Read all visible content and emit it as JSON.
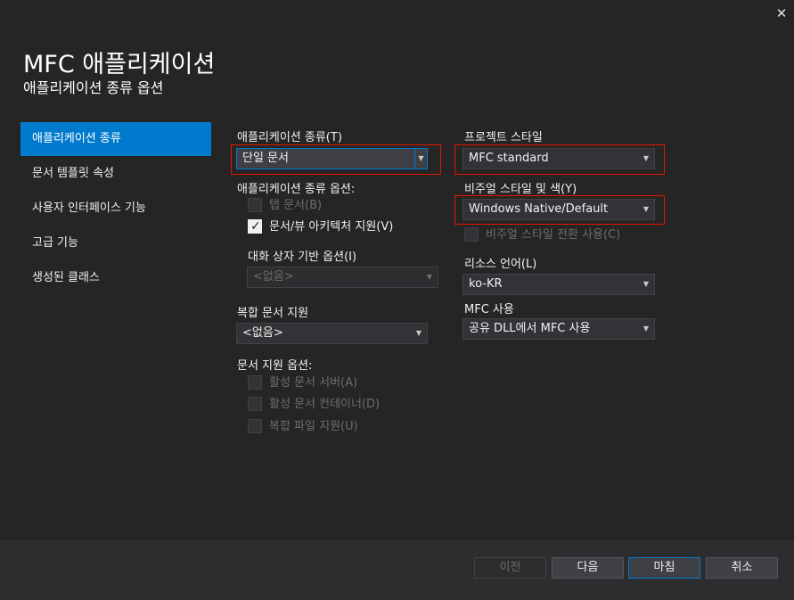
{
  "window": {
    "close_symbol": "✕"
  },
  "header": {
    "title": "MFC 애플리케이션",
    "subtitle": "애플리케이션 종류 옵션"
  },
  "sidebar": {
    "items": [
      {
        "label": "애플리케이션 종류"
      },
      {
        "label": "문서 템플릿 속성"
      },
      {
        "label": "사용자 인터페이스 기능"
      },
      {
        "label": "고급 기능"
      },
      {
        "label": "생성된 클래스"
      }
    ]
  },
  "app_type": {
    "label": "애플리케이션 종류(T)",
    "value": "단일 문서"
  },
  "app_type_options": {
    "label": "애플리케이션 종류 옵션:",
    "tabbed_docs": "탭 문서(B)",
    "doc_view": "문서/뷰 아키텍처 지원(V)",
    "dialog_label": "대화 상자 기반 옵션(I)",
    "dialog_value": "<없음>"
  },
  "compound": {
    "label": "복합 문서 지원",
    "value": "<없음>"
  },
  "doc_support": {
    "label": "문서 지원 옵션:",
    "active_server": "활성 문서 서버(A)",
    "active_container": "활성 문서 컨테이너(D)",
    "compound_file": "복합 파일 지원(U)"
  },
  "project_style": {
    "label": "프로젝트 스타일",
    "value": "MFC standard"
  },
  "visual_style": {
    "label": "비주얼 스타일 및 색(Y)",
    "value": "Windows Native/Default",
    "toggle_label": "비주얼 스타일 전환 사용(C)"
  },
  "resource_lang": {
    "label": "리소스 언어(L)",
    "value": "ko-KR"
  },
  "mfc_use": {
    "label": "MFC 사용",
    "value": "공유 DLL에서 MFC 사용"
  },
  "footer": {
    "prev": "이전",
    "next": "다음",
    "finish": "마침",
    "cancel": "취소"
  },
  "colors": {
    "accent": "#007acc",
    "highlight": "#e51400",
    "background": "#252526"
  }
}
